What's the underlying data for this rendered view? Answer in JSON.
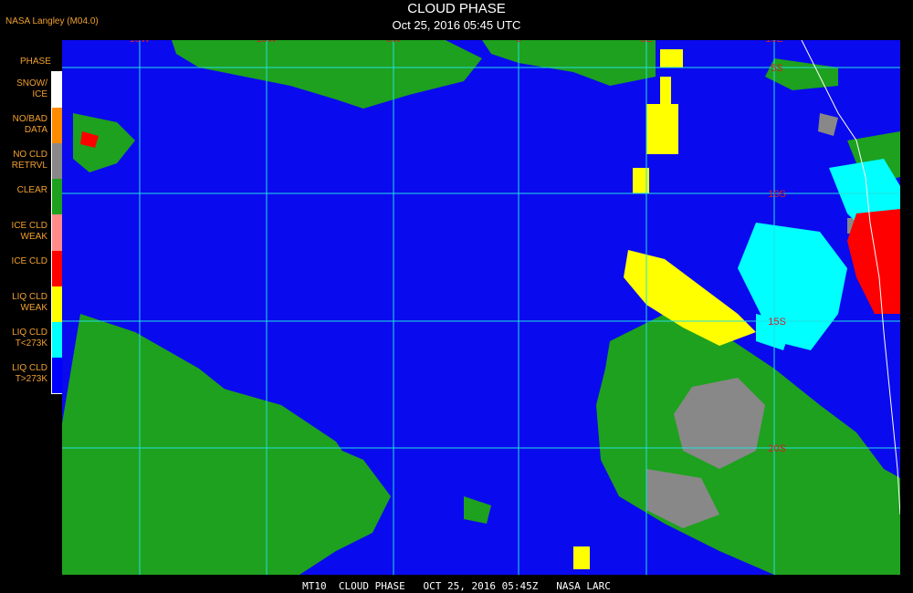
{
  "header": {
    "title": "CLOUD PHASE",
    "subtitle": "Oct 25, 2016 05:45 UTC",
    "org": "NASA Langley (M04.0)"
  },
  "legend": {
    "title": "PHASE",
    "items": [
      {
        "label": "SNOW/\nICE",
        "color": "#ffffff"
      },
      {
        "label": "NO/BAD\nDATA",
        "color": "#ff8c00"
      },
      {
        "label": "NO CLD\nRETRVL",
        "color": "#888888"
      },
      {
        "label": "CLEAR",
        "color": "#1ea11e"
      },
      {
        "label": "ICE CLD\nWEAK",
        "color": "#ff8a8a"
      },
      {
        "label": "ICE CLD",
        "color": "#ff0000"
      },
      {
        "label": "LIQ CLD\nWEAK",
        "color": "#ffff00"
      },
      {
        "label": "LIQ CLD\nT<273K",
        "color": "#00ffff"
      },
      {
        "label": "LIQ CLD\nT>273K",
        "color": "#0000ff"
      }
    ]
  },
  "map": {
    "lon_labels": [
      "15W",
      "10W",
      "5W",
      "0",
      "5E",
      "10E"
    ],
    "lat_labels": [
      "5S",
      "10S",
      "15S",
      "20S"
    ],
    "colors": {
      "ocean": "#0a0aee",
      "clear": "#1ea11e",
      "grid": "#22e0e0",
      "tick": "#d0202a"
    }
  },
  "footer": {
    "text": "MT10  CLOUD PHASE   OCT 25, 2016 05:45Z   NASA LARC"
  }
}
